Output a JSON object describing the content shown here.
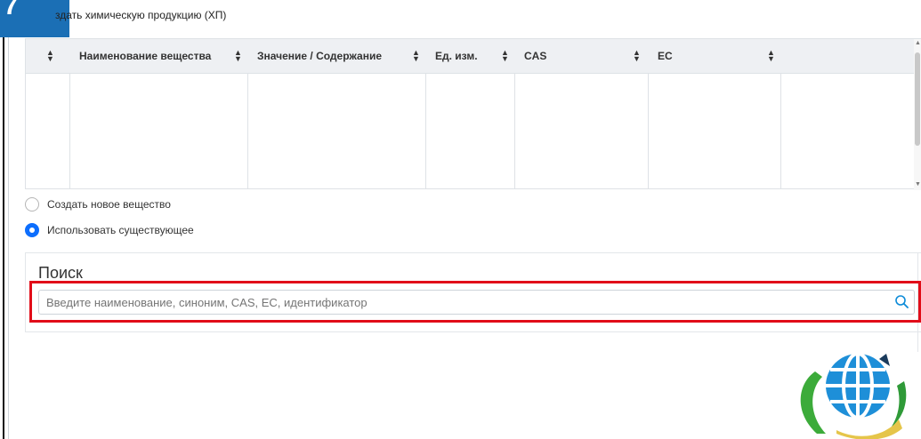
{
  "badge_text": "7",
  "header": {
    "text": "здать химическую продукцию (ХП)"
  },
  "table": {
    "columns": [
      {
        "label": ""
      },
      {
        "label": "Наименование вещества"
      },
      {
        "label": "Значение / Содержание"
      },
      {
        "label": "Ед. изм."
      },
      {
        "label": "CAS"
      },
      {
        "label": "EC"
      },
      {
        "label": ""
      }
    ],
    "rows": []
  },
  "options": {
    "create_new": "Создать новое вещество",
    "use_existing": "Использовать существующее",
    "selected": "use_existing"
  },
  "search": {
    "title": "Поиск",
    "placeholder": "Введите наименование, синоним, CAS, EC, идентификатор",
    "value": ""
  },
  "colors": {
    "accent": "#0d6efd",
    "highlight": "#e10d19"
  },
  "icons": {
    "sort": "sort-icon",
    "search": "search-icon",
    "logo": "globe-logo"
  }
}
